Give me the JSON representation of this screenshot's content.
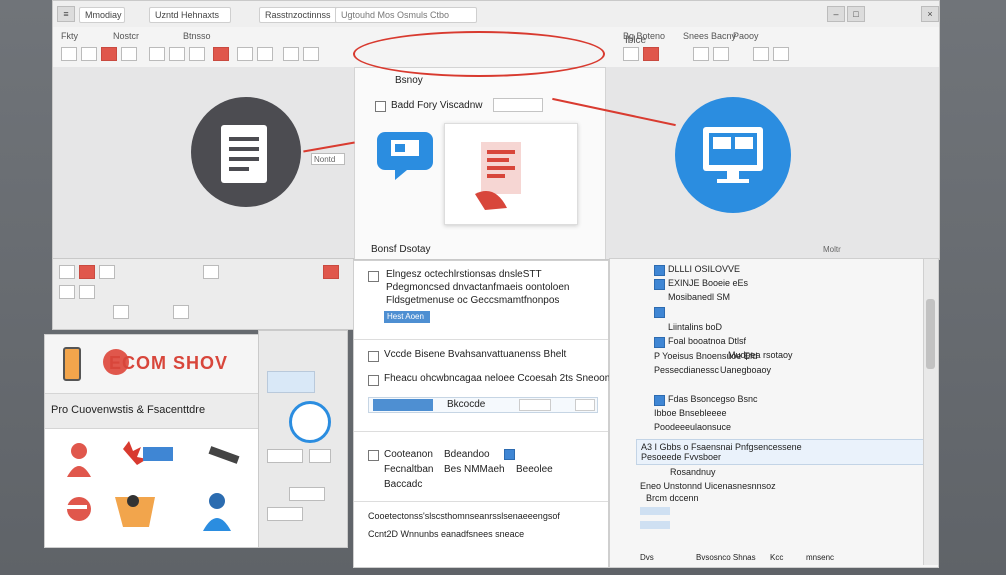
{
  "top_window": {
    "tabs": [
      "Mmodiay",
      "Uzntd Hehnaxts",
      "Rasstnzoctinnss",
      "Ugtouhd Mos Osmuls Ctbo"
    ],
    "ribbon_groups": [
      "Fkty",
      "Nostcr",
      "Btnsso",
      "Bg Boteno",
      "Snees Bacny",
      "Paooy"
    ],
    "right_labels": [
      "Iblce",
      "Moltr"
    ],
    "dialog": {
      "item1": "Bsnoy",
      "item2": "Badd Fory Viscadnw",
      "footer": "Bonsf Dsotay",
      "side_field": "Nontd"
    }
  },
  "left_card": {
    "brand": "ECOM SHOV",
    "subtitle": "Pro Cuovenwstis & Fsacenttdre"
  },
  "center_panel": {
    "para_lines": [
      "Elngesz octechlrstionsas dnsleSTT",
      "Pdegmoncsed dnvactanfmaeis oontoloen",
      "Fldsgetmenuse oc Geccsmamtfnonpos"
    ],
    "chip1": "Hest Aoen",
    "line4": "Vccde Bisene Bvahsanvattuanenss Bhelt",
    "line5": "Fheacu ohcwbncagaa neloee Ccoesah 2ts Sneoonhtens",
    "field_row_label": "Bkcocde",
    "list_a": [
      "Cooteanon",
      "Fecnaltban",
      "Baccadc"
    ],
    "list_b": [
      "Bdeandoo",
      "Bes NMMaeh",
      "Beeolee"
    ],
    "footer1": "Cooetectonss'slscsthomnseanrsslsenaeeengsof",
    "footer2": "Ccnt2D Wnnunbs eanadfsnees sneace"
  },
  "right_panel": {
    "tree": [
      "DLLLI OSILOVVE",
      "EXINJE Booeie eEs",
      "Mosibanedl SM",
      "Liintalins boD",
      "Foal booatnoa Dtlsf",
      "P Yoeisus Bnoensuoe Efd",
      "Pessecdianessc",
      "Fdas Bsoncegso Bsnc",
      "Ibboe Bnsebleeee",
      "Poodeeeulaonsuce"
    ],
    "right_col": [
      "Mudpea rsotaoy",
      "Uanegboaoy"
    ],
    "detail": {
      "header": "A3 I Gbbs o Fsaensnai Pnfgsencessene",
      "sub": "Pesoeede Fvvsboer",
      "title": "Rosandnuy",
      "l1": "Eneo Unstonnd Uicenasnesnnsoz",
      "l2": "Brcm dccenn"
    },
    "status": [
      "Dvs",
      "Bvsosnco Shnas",
      "Kcc",
      "mnsenc"
    ]
  },
  "colors": {
    "accent_red": "#d83a2f",
    "accent_blue": "#2b8de0",
    "dark_circle": "#4c4c51"
  }
}
